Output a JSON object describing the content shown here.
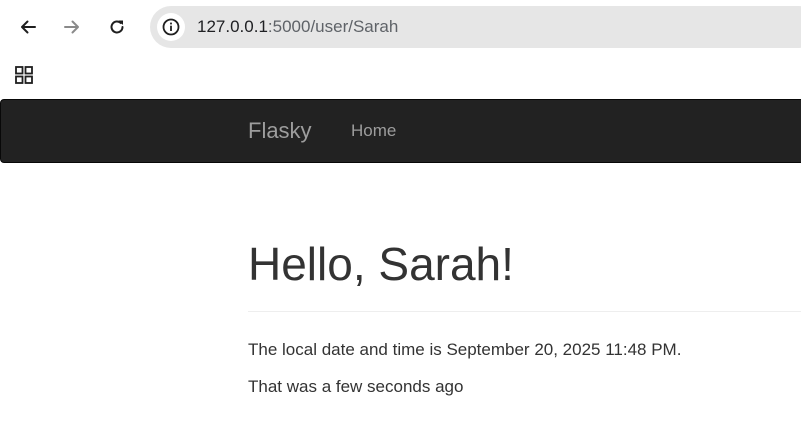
{
  "browser": {
    "url_host": "127.0.0.1",
    "url_rest": ":5000/user/Sarah",
    "icons": {
      "back": "back-arrow-icon",
      "forward": "forward-arrow-icon",
      "reload": "reload-icon",
      "site_info": "info-icon",
      "apps": "apps-grid-icon"
    }
  },
  "navbar": {
    "brand": "Flasky",
    "links": [
      {
        "label": "Home"
      }
    ],
    "background": "#222222",
    "text_color": "#9d9d9d"
  },
  "main": {
    "title": "Hello, Sarah!",
    "datetime_line": "The local date and time is September 20, 2025 11:48 PM.",
    "relative_line": "That was a few seconds ago"
  }
}
